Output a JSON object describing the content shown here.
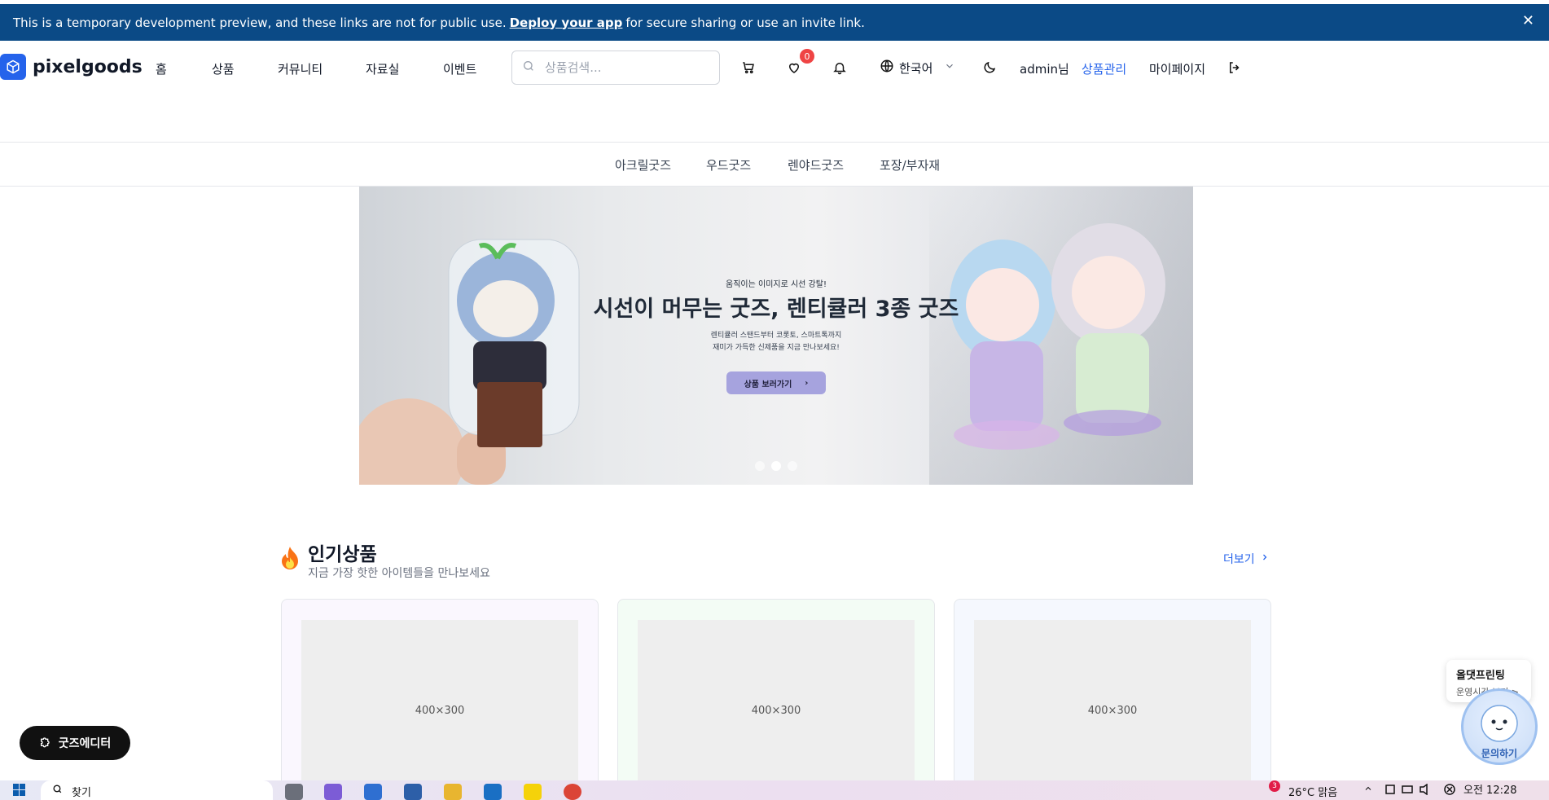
{
  "preview_banner": {
    "text_before": "This is a temporary development preview, and these links are not for public use.",
    "link_text": "Deploy your app",
    "text_after": "for secure sharing or use an invite link.",
    "close_glyph": "✕"
  },
  "header": {
    "logo_text": "pixelgoods",
    "nav": [
      "홈",
      "상품",
      "커뮤니티",
      "자료실",
      "이벤트"
    ],
    "search_placeholder": "상품검색...",
    "wishlist_badge": "0",
    "language": "한국어",
    "user_greeting": "admin님",
    "admin_link": "상품관리",
    "mypage_link": "마이페이지",
    "accent_color": "#2563eb"
  },
  "categories": [
    "아크릴굿즈",
    "우드굿즈",
    "렌야드굿즈",
    "포장/부자재"
  ],
  "hero": {
    "kicker": "움직이는 이미지로 시선 강탈!",
    "title": "시선이 머무는 굿즈, 렌티큘러 3종 굿즈",
    "desc_line1": "렌티큘러 스탠드부터 코롯토, 스마트톡까지",
    "desc_line2": "재미가 가득한 신제품을 지금 만나보세요!",
    "button_label": "상품 보러가기",
    "button_arrow": "›",
    "slide_count": 3,
    "active_slide": 2
  },
  "popular": {
    "title": "인기상품",
    "subtitle": "지금 가장 핫한 아이템들을 만나보세요",
    "more_label": "더보기",
    "cards": [
      {
        "placeholder": "400×300",
        "tint": "#faf7fe"
      },
      {
        "placeholder": "400×300",
        "tint": "#f3fcf5"
      },
      {
        "placeholder": "400×300",
        "tint": "#f5f8fe"
      }
    ]
  },
  "floating": {
    "editor_button": "굿즈에디터",
    "inquiry_title": "올댓프린팅",
    "inquiry_sub": "운영시간 보기 >",
    "inquiry_button": "문의하기"
  },
  "taskbar": {
    "search_text": "찾기",
    "weather": "26°C 맑음",
    "notification_count": "3",
    "clock": "오전 12:28"
  }
}
